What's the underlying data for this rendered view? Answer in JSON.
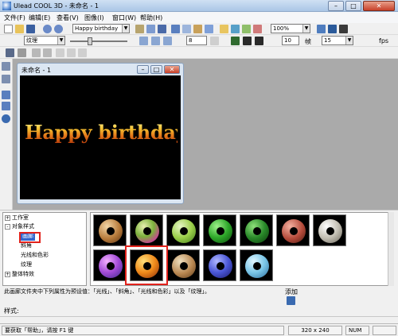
{
  "window": {
    "title": "Ulead COOL 3D - 未命名 - 1",
    "min": "–",
    "max": "□",
    "close": "✕"
  },
  "menu": [
    "文件(F)",
    "编辑(E)",
    "查看(V)",
    "图像(I)",
    "窗口(W)",
    "帮助(H)"
  ],
  "toolbar1": {
    "text_value": "Happy birthday",
    "zoom_value": "100%"
  },
  "toolbar2": {
    "attribute_value": "纹理",
    "field_a": "8",
    "field_b": "10",
    "field_c": "15",
    "frame_label": "帧",
    "fps_label": "fps"
  },
  "document": {
    "title": "未命名 - 1",
    "canvas_text": "Happy birthday"
  },
  "tree": {
    "items": [
      {
        "label": "工作室",
        "exp": "+"
      },
      {
        "label": "对象样式",
        "exp": "-"
      },
      {
        "label": "画廊",
        "exp": ""
      },
      {
        "label": "斜角",
        "exp": ""
      },
      {
        "label": "光线和色彩",
        "exp": ""
      },
      {
        "label": "纹理",
        "exp": ""
      },
      {
        "label": "整体特效",
        "exp": "+"
      }
    ]
  },
  "gallery": {
    "thumbs": [
      {
        "color": "radial-gradient(circle at 35% 30%,#f2d6a6,#b67a3a 55%,#5a3415)"
      },
      {
        "color": "radial-gradient(circle at 35% 30%,#e8f0b0,#7bb13a 45%,#c44a8e 75%,#3a2a5a)"
      },
      {
        "color": "radial-gradient(circle at 35% 30%,#e6f5c6,#9ccf4a 50%,#3f7a1a)"
      },
      {
        "color": "radial-gradient(circle at 35% 30%,#9ef08a,#2ea82a 50%,#0d4a0d)"
      },
      {
        "color": "radial-gradient(circle at 35% 30%,#8ee07a,#2a8a2a 50%,#0a3a0a)"
      },
      {
        "color": "radial-gradient(circle at 35% 30%,#f3b0a0,#b44a3a 55%,#4a1a12)"
      },
      {
        "color": "radial-gradient(circle at 35% 30%,#ffffff,#c4c0b4 50%,#6a665c)"
      },
      {
        "color": "radial-gradient(circle at 35% 30%,#f4b0ff,#a24ad6 50%,#3a2a8a)"
      },
      {
        "color": "radial-gradient(circle at 35% 30%,#ffe07a,#f08a1a 50%,#8a2a08)"
      },
      {
        "color": "radial-gradient(circle at 35% 30%,#f0e0c0,#b88650 55%,#5a3a1a)"
      },
      {
        "color": "radial-gradient(circle at 35% 30%,#b0b8ff,#4a56d6 50%,#1a1a6a)"
      },
      {
        "color": "radial-gradient(circle at 35% 30%,#e0f6ff,#7ac6e8 50%,#2a6a9a)"
      }
    ]
  },
  "description": "此画廊文件夹中下列属性为预设值：「光线」、「斜角」、「光线和色彩」以及「纹理」。",
  "add_label": "添加",
  "style_label": "样式:",
  "status": {
    "help": "要获取「帮助」，请按 F1 键",
    "size": "320 x 240",
    "num": "NUM"
  },
  "colors": {
    "highlight": "#e1221c"
  }
}
